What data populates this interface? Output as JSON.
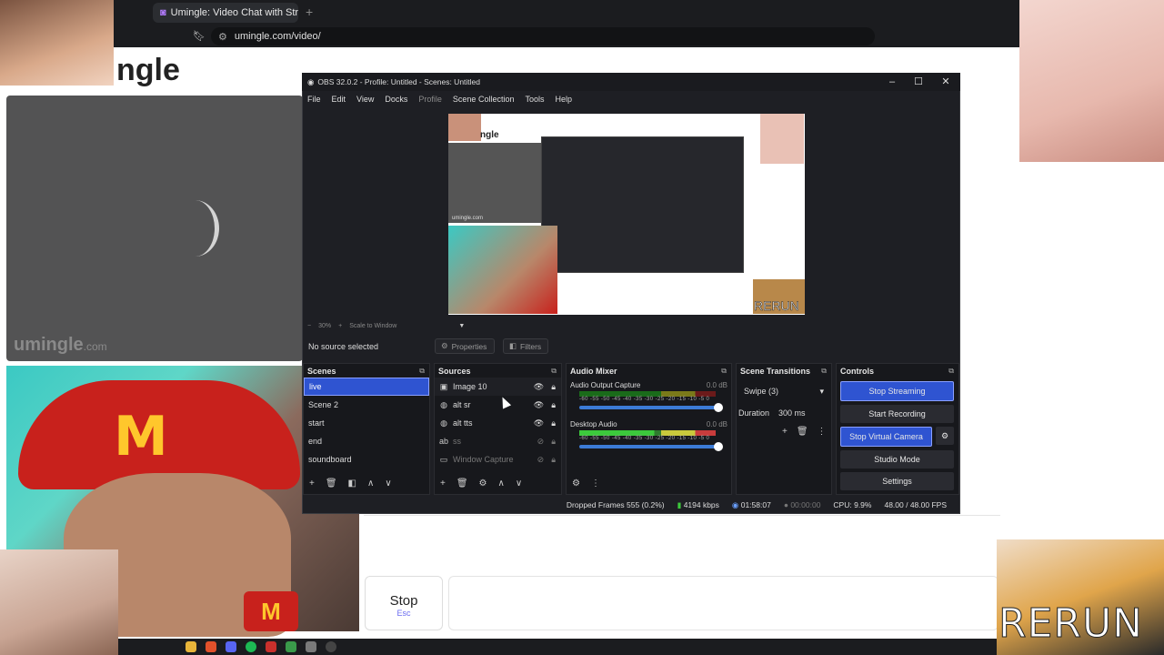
{
  "browser": {
    "tab_title": "Umingle: Video Chat with Str",
    "url": "umingle.com/video/"
  },
  "page": {
    "logo_text": "ngle",
    "watermark_main": "umingle",
    "watermark_suffix": ".com",
    "stop_label": "Stop",
    "stop_hint": "Esc"
  },
  "obs": {
    "title": "OBS 32.0.2 - Profile: Untitled - Scenes: Untitled",
    "menu": [
      "File",
      "Edit",
      "View",
      "Docks",
      "Profile",
      "Scene Collection",
      "Tools",
      "Help"
    ],
    "zoom": {
      "minus": "−",
      "percent": "30%",
      "plus": "+",
      "mode": "Scale to Window"
    },
    "no_source": "No source selected",
    "properties_label": "Properties",
    "filters_label": "Filters",
    "preview": {
      "logo": "ngle",
      "wm": "umingle.com",
      "rerun": "RERUN"
    },
    "scenes": {
      "title": "Scenes",
      "items": [
        "live",
        "Scene 2",
        "start",
        "end",
        "soundboard"
      ]
    },
    "sources": {
      "title": "Sources",
      "items": [
        {
          "name": "Image 10",
          "icon": "image-icon"
        },
        {
          "name": "alt sr",
          "icon": "browser-icon"
        },
        {
          "name": "alt tts",
          "icon": "browser-icon"
        },
        {
          "name": "ss",
          "icon": "text-icon"
        },
        {
          "name": "Window Capture",
          "icon": "window-icon"
        }
      ]
    },
    "mixer": {
      "title": "Audio Mixer",
      "channels": [
        {
          "name": "Audio Output Capture",
          "level": "0.0 dB"
        },
        {
          "name": "Desktop Audio",
          "level": "0.0 dB"
        }
      ],
      "scale": "-60 -55 -50 -45 -40 -35 -30 -25 -20 -15 -10 -5 0"
    },
    "transitions": {
      "title": "Scene Transitions",
      "selected": "Swipe (3)",
      "duration_label": "Duration",
      "duration_value": "300 ms"
    },
    "controls": {
      "title": "Controls",
      "stop_streaming": "Stop Streaming",
      "start_recording": "Start Recording",
      "stop_virtual_camera": "Stop Virtual Camera",
      "studio_mode": "Studio Mode",
      "settings": "Settings"
    },
    "status": {
      "dropped": "Dropped Frames 555 (0.2%)",
      "bitrate": "4194 kbps",
      "stream_time": "01:58:07",
      "record_time": "00:00:00",
      "cpu": "CPU: 9.9%",
      "fps": "48.00 / 48.00 FPS"
    }
  },
  "overlay": {
    "rerun": "RERUN"
  },
  "colors": {
    "accent": "#2f54d1",
    "brand_red": "#c8211c",
    "brand_yellow": "#ffc72c"
  }
}
